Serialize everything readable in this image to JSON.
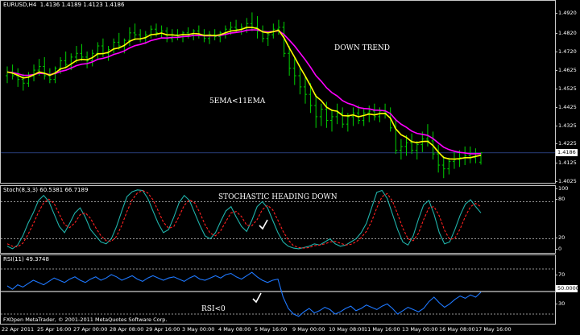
{
  "chart_data": [
    {
      "type": "candlestick",
      "symbol": "EURUSD,H4",
      "ohlc": [
        "1.4136",
        "1.4189",
        "1.4123",
        "1.4186"
      ],
      "annotations": [
        "DOWN TREND",
        "5EMA<11EMA"
      ],
      "series": [
        {
          "name": "EMA5",
          "color": "#ffff00"
        },
        {
          "name": "EMA11",
          "color": "#ff00ff"
        }
      ],
      "price_ticks": [
        "1.4920",
        "1.4820",
        "1.4720",
        "1.4625",
        "1.4525",
        "1.4425",
        "1.4325",
        "1.4225",
        "1.4125",
        "1.4025"
      ],
      "current_price": "1.4186",
      "ylim": [
        1.4025,
        1.4985
      ],
      "up_color": "#00d000",
      "down_color": "#00d000",
      "data": [
        [
          1.46,
          1.465,
          1.456,
          1.462
        ],
        [
          1.462,
          1.466,
          1.458,
          1.46
        ],
        [
          1.46,
          1.464,
          1.454,
          1.458
        ],
        [
          1.458,
          1.461,
          1.452,
          1.456
        ],
        [
          1.456,
          1.462,
          1.454,
          1.46
        ],
        [
          1.46,
          1.466,
          1.457,
          1.463
        ],
        [
          1.463,
          1.469,
          1.46,
          1.465
        ],
        [
          1.465,
          1.47,
          1.458,
          1.46
        ],
        [
          1.46,
          1.464,
          1.456,
          1.458
        ],
        [
          1.458,
          1.465,
          1.456,
          1.464
        ],
        [
          1.464,
          1.47,
          1.461,
          1.468
        ],
        [
          1.468,
          1.473,
          1.464,
          1.466
        ],
        [
          1.466,
          1.472,
          1.463,
          1.47
        ],
        [
          1.47,
          1.476,
          1.467,
          1.472
        ],
        [
          1.472,
          1.477,
          1.468,
          1.47
        ],
        [
          1.47,
          1.473,
          1.464,
          1.468
        ],
        [
          1.468,
          1.474,
          1.465,
          1.472
        ],
        [
          1.472,
          1.478,
          1.469,
          1.476
        ],
        [
          1.476,
          1.48,
          1.47,
          1.472
        ],
        [
          1.472,
          1.476,
          1.468,
          1.474
        ],
        [
          1.474,
          1.48,
          1.472,
          1.478
        ],
        [
          1.478,
          1.483,
          1.474,
          1.476
        ],
        [
          1.476,
          1.48,
          1.472,
          1.479
        ],
        [
          1.479,
          1.486,
          1.476,
          1.483
        ],
        [
          1.483,
          1.488,
          1.479,
          1.482
        ],
        [
          1.482,
          1.485,
          1.478,
          1.48
        ],
        [
          1.48,
          1.484,
          1.477,
          1.482
        ],
        [
          1.482,
          1.487,
          1.48,
          1.485
        ],
        [
          1.485,
          1.488,
          1.481,
          1.483
        ],
        [
          1.483,
          1.487,
          1.48,
          1.484
        ],
        [
          1.484,
          1.486,
          1.478,
          1.48
        ],
        [
          1.48,
          1.485,
          1.478,
          1.482
        ],
        [
          1.482,
          1.485,
          1.479,
          1.481
        ],
        [
          1.481,
          1.484,
          1.478,
          1.483
        ],
        [
          1.483,
          1.486,
          1.48,
          1.482
        ],
        [
          1.482,
          1.485,
          1.479,
          1.484
        ],
        [
          1.484,
          1.487,
          1.48,
          1.482
        ],
        [
          1.482,
          1.485,
          1.478,
          1.48
        ],
        [
          1.48,
          1.484,
          1.477,
          1.482
        ],
        [
          1.482,
          1.485,
          1.479,
          1.481
        ],
        [
          1.481,
          1.484,
          1.478,
          1.483
        ],
        [
          1.483,
          1.487,
          1.48,
          1.485
        ],
        [
          1.485,
          1.489,
          1.482,
          1.486
        ],
        [
          1.486,
          1.49,
          1.483,
          1.485
        ],
        [
          1.485,
          1.488,
          1.482,
          1.486
        ],
        [
          1.486,
          1.491,
          1.483,
          1.488
        ],
        [
          1.488,
          1.494,
          1.484,
          1.486
        ],
        [
          1.486,
          1.492,
          1.48,
          1.484
        ],
        [
          1.484,
          1.487,
          1.478,
          1.48
        ],
        [
          1.48,
          1.484,
          1.476,
          1.482
        ],
        [
          1.482,
          1.488,
          1.48,
          1.485
        ],
        [
          1.485,
          1.49,
          1.482,
          1.486
        ],
        [
          1.486,
          1.489,
          1.47,
          1.472
        ],
        [
          1.472,
          1.476,
          1.46,
          1.464
        ],
        [
          1.464,
          1.47,
          1.455,
          1.46
        ],
        [
          1.46,
          1.464,
          1.45,
          1.454
        ],
        [
          1.454,
          1.46,
          1.445,
          1.45
        ],
        [
          1.45,
          1.456,
          1.44,
          1.444
        ],
        [
          1.444,
          1.45,
          1.432,
          1.438
        ],
        [
          1.438,
          1.445,
          1.433,
          1.442
        ],
        [
          1.442,
          1.446,
          1.432,
          1.436
        ],
        [
          1.436,
          1.442,
          1.43,
          1.438
        ],
        [
          1.438,
          1.445,
          1.434,
          1.44
        ],
        [
          1.44,
          1.443,
          1.432,
          1.434
        ],
        [
          1.434,
          1.44,
          1.43,
          1.438
        ],
        [
          1.438,
          1.443,
          1.433,
          1.44
        ],
        [
          1.44,
          1.444,
          1.434,
          1.436
        ],
        [
          1.436,
          1.442,
          1.433,
          1.44
        ],
        [
          1.44,
          1.444,
          1.435,
          1.441
        ],
        [
          1.441,
          1.445,
          1.436,
          1.438
        ],
        [
          1.438,
          1.443,
          1.435,
          1.441
        ],
        [
          1.441,
          1.445,
          1.437,
          1.44
        ],
        [
          1.44,
          1.443,
          1.43,
          1.432
        ],
        [
          1.432,
          1.436,
          1.418,
          1.42
        ],
        [
          1.42,
          1.426,
          1.415,
          1.422
        ],
        [
          1.422,
          1.428,
          1.417,
          1.424
        ],
        [
          1.424,
          1.429,
          1.418,
          1.42
        ],
        [
          1.42,
          1.425,
          1.415,
          1.423
        ],
        [
          1.423,
          1.43,
          1.419,
          1.426
        ],
        [
          1.426,
          1.434,
          1.422,
          1.425
        ],
        [
          1.425,
          1.43,
          1.415,
          1.418
        ],
        [
          1.418,
          1.423,
          1.408,
          1.412
        ],
        [
          1.412,
          1.417,
          1.405,
          1.41
        ],
        [
          1.41,
          1.416,
          1.407,
          1.414
        ],
        [
          1.414,
          1.419,
          1.41,
          1.415
        ],
        [
          1.415,
          1.42,
          1.411,
          1.416
        ],
        [
          1.416,
          1.422,
          1.412,
          1.417
        ],
        [
          1.417,
          1.422,
          1.413,
          1.416
        ],
        [
          1.416,
          1.421,
          1.413,
          1.418
        ],
        [
          1.4136,
          1.4189,
          1.4123,
          1.4186
        ]
      ]
    },
    {
      "type": "line",
      "indicator": "Stoch(8,3,3)",
      "values_text": [
        "60.5381",
        "66.7189"
      ],
      "annotation": "STOCHASTIC HEADING DOWN",
      "levels": [
        80,
        20
      ],
      "ticks": [
        "100",
        "80",
        "20",
        "0"
      ],
      "ylim": [
        0,
        100
      ],
      "series": [
        {
          "name": "main",
          "color": "#20b2aa",
          "values": [
            8,
            4,
            10,
            25,
            45,
            62,
            82,
            90,
            80,
            60,
            40,
            30,
            45,
            62,
            70,
            55,
            35,
            25,
            15,
            12,
            20,
            40,
            65,
            88,
            96,
            99,
            98,
            85,
            65,
            45,
            30,
            35,
            55,
            78,
            90,
            82,
            62,
            42,
            25,
            20,
            30,
            48,
            65,
            72,
            55,
            40,
            32,
            50,
            72,
            80,
            70,
            50,
            30,
            15,
            8,
            5,
            4,
            6,
            8,
            12,
            10,
            15,
            20,
            12,
            8,
            10,
            15,
            20,
            30,
            45,
            70,
            95,
            98,
            85,
            60,
            35,
            15,
            10,
            25,
            52,
            75,
            82,
            60,
            30,
            12,
            15,
            35,
            58,
            76,
            83,
            72,
            62
          ]
        },
        {
          "name": "signal",
          "color": "#ff2020",
          "values": [
            12,
            8,
            7,
            13,
            27,
            44,
            63,
            78,
            84,
            77,
            60,
            43,
            38,
            46,
            59,
            62,
            53,
            38,
            25,
            17,
            16,
            24,
            42,
            64,
            83,
            94,
            98,
            94,
            83,
            65,
            47,
            37,
            40,
            56,
            74,
            83,
            78,
            62,
            43,
            29,
            25,
            33,
            48,
            62,
            64,
            56,
            42,
            41,
            51,
            67,
            74,
            67,
            50,
            32,
            18,
            9,
            6,
            5,
            6,
            9,
            10,
            12,
            15,
            16,
            13,
            10,
            11,
            15,
            22,
            32,
            48,
            70,
            88,
            93,
            81,
            60,
            37,
            20,
            17,
            29,
            51,
            70,
            72,
            57,
            34,
            19,
            21,
            36,
            56,
            72,
            77,
            72
          ]
        }
      ]
    },
    {
      "type": "line",
      "indicator": "RSI(11)",
      "values_text": [
        "49.3748"
      ],
      "annotation": "RSI<0",
      "levels": [
        70,
        50,
        30
      ],
      "ticks": [
        "70",
        "50.0000",
        "30"
      ],
      "ylim": [
        0,
        100
      ],
      "series": [
        {
          "name": "RSI",
          "color": "#1e78ff",
          "values": [
            55,
            52,
            56,
            54,
            57,
            60,
            58,
            56,
            59,
            62,
            60,
            58,
            61,
            63,
            60,
            58,
            61,
            63,
            60,
            62,
            65,
            63,
            60,
            62,
            64,
            61,
            59,
            62,
            64,
            62,
            60,
            62,
            63,
            61,
            59,
            62,
            64,
            61,
            60,
            62,
            64,
            62,
            65,
            66,
            63,
            61,
            64,
            67,
            63,
            60,
            58,
            60,
            61,
            45,
            35,
            30,
            28,
            32,
            35,
            31,
            33,
            36,
            34,
            30,
            32,
            35,
            37,
            33,
            35,
            38,
            36,
            34,
            37,
            39,
            35,
            30,
            33,
            36,
            34,
            32,
            35,
            41,
            45,
            40,
            36,
            39,
            43,
            46,
            44,
            47,
            45,
            49.37
          ]
        }
      ]
    }
  ],
  "time_axis": [
    "22 Apr 2011",
    "25 Apr 16:00",
    "27 Apr 00:00",
    "28 Apr 08:00",
    "29 Apr 16:00",
    "3 May 00:00",
    "4 May 08:00",
    "5 May 16:00",
    "9 May 00:00",
    "10 May 08:00",
    "11 May 16:00",
    "13 May 00:00",
    "16 May 08:00",
    "17 May 16:00"
  ],
  "copyright": "FXOpen MetaTrader, © 2001-2011 MetaQuotes Software Corp.",
  "colors": {
    "background": "#000000",
    "grid": "#c8c8c8",
    "text": "#ffffff"
  }
}
